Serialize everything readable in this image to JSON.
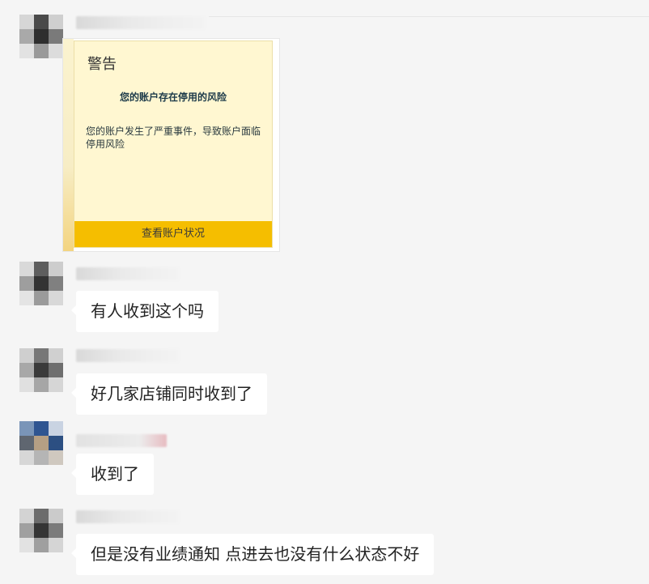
{
  "colors": {
    "background": "#f5f5f5",
    "bubble": "#ffffff",
    "card_background": "#fff7d1",
    "card_button": "#f5be00"
  },
  "image_card": {
    "title": "警告",
    "heading": "您的账户存在停用的风险",
    "body": "您的账户发生了严重事件，导致账户面临停用风险",
    "button_label": "查看账户状况"
  },
  "messages": [
    {
      "text": "有人收到这个吗"
    },
    {
      "text": "好几家店铺同时收到了"
    },
    {
      "text": "收到了"
    },
    {
      "text": "但是没有业绩通知 点进去也没有什么状态不好"
    }
  ]
}
